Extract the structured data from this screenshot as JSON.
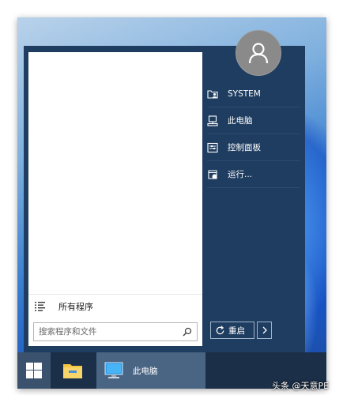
{
  "start_menu": {
    "all_programs_label": "所有程序",
    "search": {
      "placeholder": "搜索程序和文件",
      "value": ""
    },
    "right_items": [
      {
        "label": "SYSTEM",
        "icon": "user-folder-icon"
      },
      {
        "label": "此电脑",
        "icon": "computer-icon"
      },
      {
        "label": "控制面板",
        "icon": "control-panel-icon"
      },
      {
        "label": "运行...",
        "icon": "run-icon"
      }
    ],
    "restart_label": "重启",
    "colors": {
      "menu_bg": "#1f3d60",
      "programs_bg": "#ffffff"
    }
  },
  "taskbar": {
    "items": [
      {
        "icon": "windows-logo-icon"
      },
      {
        "icon": "file-explorer-icon"
      },
      {
        "icon": "this-pc-icon",
        "label": "此电脑"
      }
    ],
    "colors": {
      "bg": "#1b2f48",
      "active": "#4a6584"
    }
  },
  "watermark": "头条 @天意PE"
}
